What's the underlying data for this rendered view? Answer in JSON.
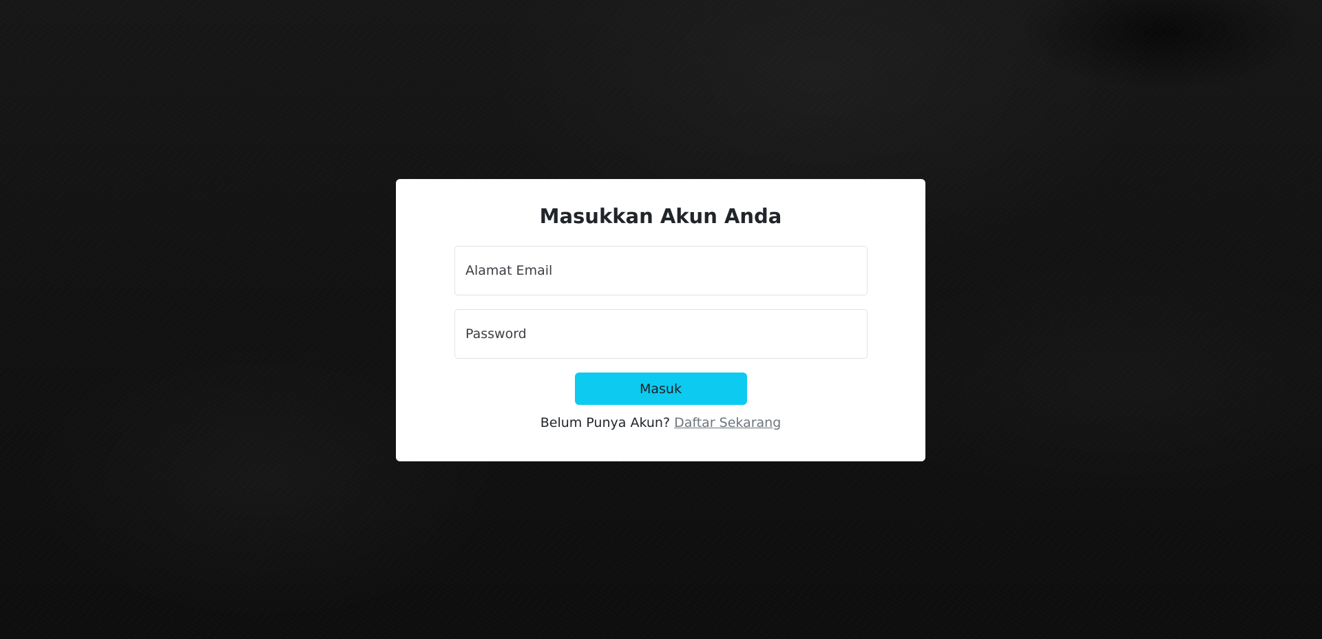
{
  "login": {
    "title": "Masukkan Akun Anda",
    "email_placeholder": "Alamat Email",
    "password_placeholder": "Password",
    "submit_label": "Masuk",
    "register_prompt": "Belum Punya Akun?",
    "register_link": "Daftar Sekarang"
  },
  "colors": {
    "background": "#141414",
    "card": "#ffffff",
    "button": "#0dcaf0",
    "link": "#6c757d",
    "text": "#212529"
  }
}
